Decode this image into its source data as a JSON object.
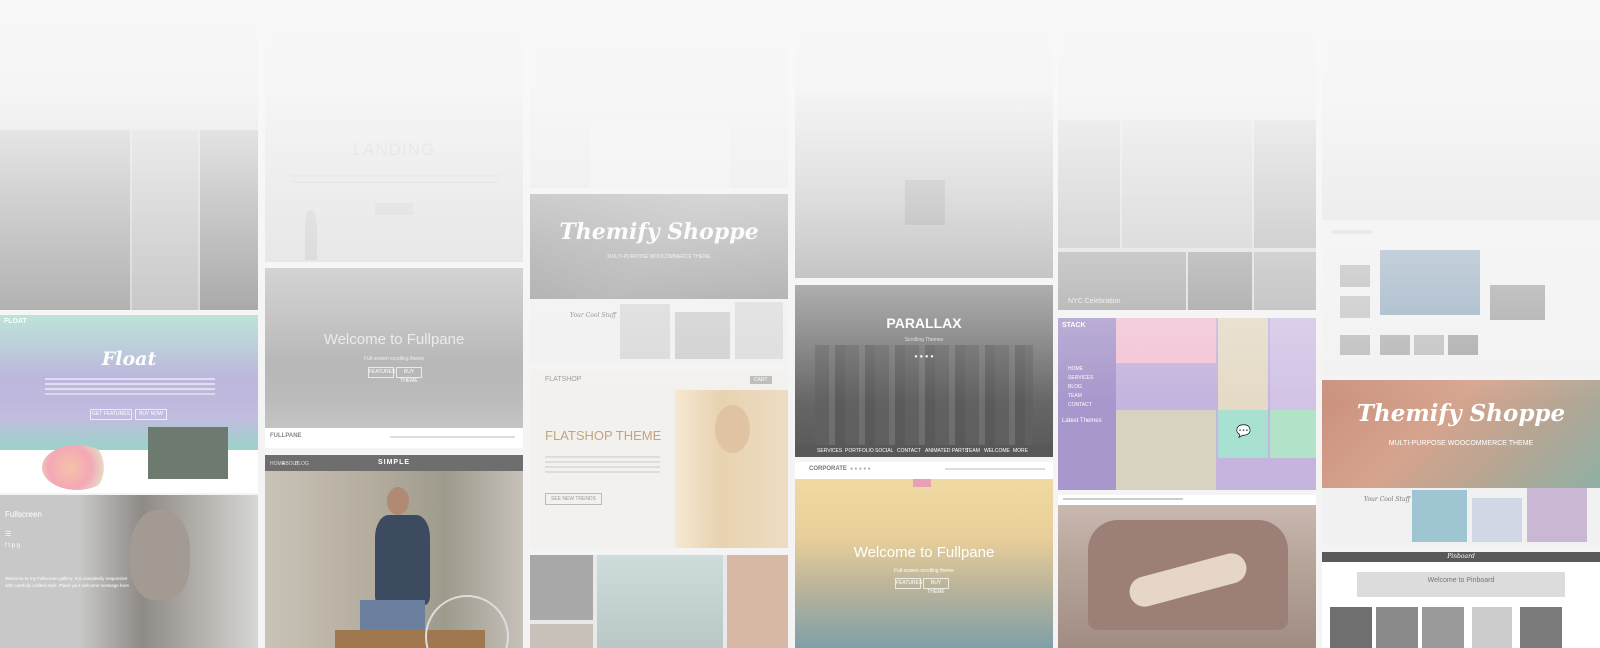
{
  "themes": {
    "landing": {
      "title": "LANDING"
    },
    "float": {
      "logo": "FLOAT",
      "title": "Float",
      "btn1": "GET FEATURES",
      "btn2": "BUY NOW"
    },
    "fullscreen": {
      "logo": "Fullscreen",
      "caption": "Welcome to my Fullscreen gallery. It is completely responsive with carefully crafted style. Place your welcome message here"
    },
    "fullpane": {
      "welcome": "Welcome to Fullpane",
      "sub": "Full-screen scrolling theme",
      "btn1": "FEATURES",
      "btn2": "BUY THEME",
      "logo": "FULLPANE"
    },
    "simple": {
      "logo": "SIMPLE",
      "nav": [
        "HOME",
        "ABOUT",
        "BLOG"
      ]
    },
    "shoppe": {
      "title": "Themify Shoppe",
      "sub": "MULTI-PURPOSE WOOCOMMERCE THEME",
      "product": "Your Cool Stuff"
    },
    "flatshop": {
      "logo": "FLATSHOP",
      "title": "FLATSHOP THEME",
      "button": "SEE NEW TRENDS",
      "cart": "CART"
    },
    "parallax": {
      "title": "PARALLAX",
      "sub": "Scrolling Themes",
      "nav": [
        "SERVICES",
        "PORTFOLIO",
        "SOCIAL",
        "CONTACT",
        "ANIMATED PARTS",
        "TEAM",
        "WELCOME",
        "MORE"
      ]
    },
    "corporate": {
      "logo": "CORPORATE"
    },
    "fullpane2": {
      "welcome": "Welcome to Fullpane",
      "sub": "Full-screen scrolling theme",
      "btn1": "FEATURES",
      "btn2": "BUY THEME"
    },
    "stack": {
      "logo": "STACK",
      "menu": [
        "HOME",
        "SERVICES",
        "BLOG",
        "TEAM",
        "CONTACT"
      ],
      "aside": "Latest Themes"
    },
    "pinboard": {
      "welcome": "Welcome to Pinboard",
      "logo": "Pinboard"
    },
    "nyc": {
      "label": "NYC Celebration"
    }
  },
  "colors": {
    "float_gradient_a": "#b7b3d8",
    "float_gradient_b": "#a8dccb",
    "stack_purple": "#c4b4de",
    "stack_pink": "#f3c3d5",
    "stack_teal": "#a8e0d1",
    "corporate_top": "#f1d9a3",
    "corporate_bottom": "#7fa0a8"
  }
}
